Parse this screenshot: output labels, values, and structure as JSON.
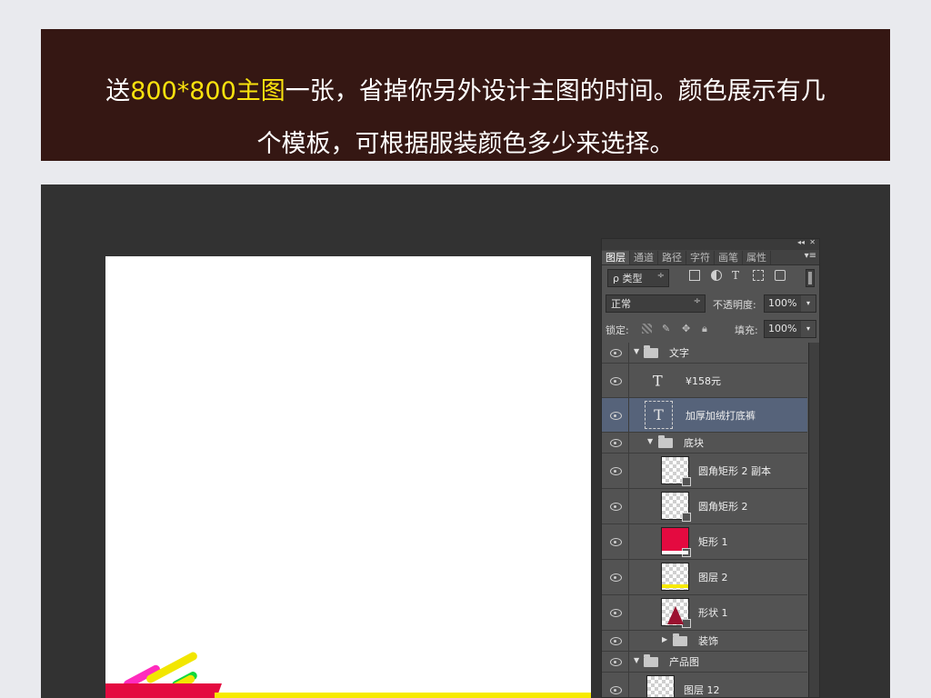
{
  "banner": {
    "line1_pre": "送",
    "line1_highlight": "800*800主图",
    "line1_post": "一张，省掉你另外设计主图的时间。颜色展示有几",
    "line2": "个模板，可根据服装颜色多少来选择。",
    "background_color": "#351713",
    "highlight_color": "#f9e20e"
  },
  "layers_panel": {
    "tabs": [
      "图层",
      "通道",
      "路径",
      "字符",
      "画笔",
      "属性"
    ],
    "active_tab": "图层",
    "filter": {
      "label": "ρ 类型",
      "arrow": "÷"
    },
    "filter_icons": [
      "image-filter-icon",
      "adjustment-filter-icon",
      "type-filter-icon",
      "shape-filter-icon",
      "smart-object-filter-icon"
    ],
    "blend_mode": "正常",
    "opacity_label": "不透明度:",
    "opacity_value": "100%",
    "lock_label": "锁定:",
    "fill_label": "填充:",
    "fill_value": "100%",
    "layers": [
      {
        "name": "文字",
        "type": "group",
        "expanded": true,
        "indent": 0
      },
      {
        "name": "¥158元",
        "type": "text",
        "indent": 1
      },
      {
        "name": "加厚加绒打底裤",
        "type": "text",
        "indent": 1,
        "selected": true
      },
      {
        "name": "底块",
        "type": "group",
        "expanded": true,
        "indent": 1
      },
      {
        "name": "圆角矩形 2 副本",
        "type": "shape",
        "indent": 2
      },
      {
        "name": "圆角矩形 2",
        "type": "shape",
        "indent": 2
      },
      {
        "name": "矩形 1",
        "type": "shape",
        "indent": 2,
        "color": "#e40a40"
      },
      {
        "name": "图层 2",
        "type": "pixel",
        "indent": 2
      },
      {
        "name": "形状 1",
        "type": "shape",
        "indent": 2,
        "color": "#9b1130"
      },
      {
        "name": "装饰",
        "type": "group",
        "expanded": false,
        "indent": 2
      },
      {
        "name": "产品图",
        "type": "group",
        "expanded": true,
        "indent": 0
      },
      {
        "name": "图层 12",
        "type": "pixel",
        "indent": 1
      }
    ]
  },
  "canvas": {
    "accent_colors": [
      "#ff2bbd",
      "#f2e600",
      "#11d93c",
      "#e40a40"
    ]
  }
}
